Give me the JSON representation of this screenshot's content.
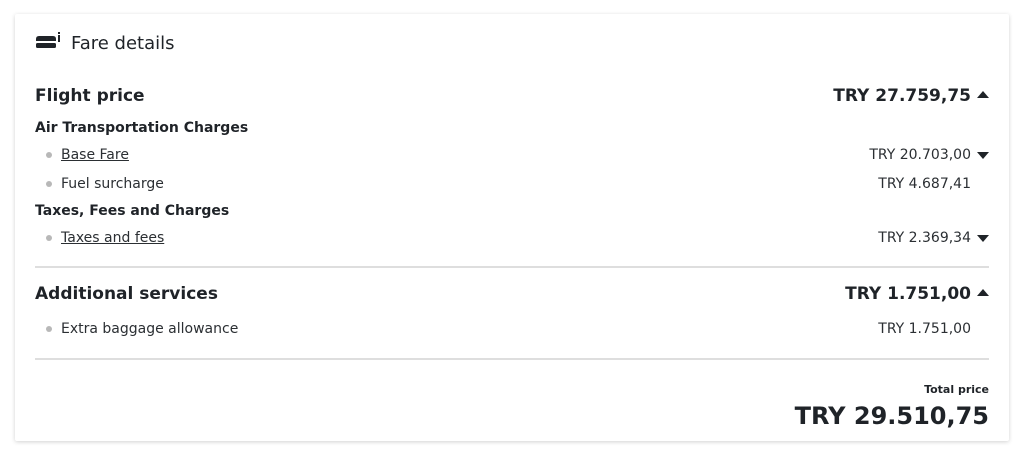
{
  "header": {
    "title": "Fare details",
    "icon": "seat-info-icon"
  },
  "flight_price": {
    "title": "Flight price",
    "amount": "TRY 27.759,75",
    "groups": [
      {
        "title": "Air Transportation Charges",
        "items": [
          {
            "label": "Base Fare",
            "amount": "TRY 20.703,00"
          },
          {
            "label": "Fuel surcharge",
            "amount": "TRY 4.687,41"
          }
        ]
      },
      {
        "title": "Taxes, Fees and Charges",
        "items": [
          {
            "label": "Taxes and fees",
            "amount": "TRY 2.369,34"
          }
        ]
      }
    ]
  },
  "additional_services": {
    "title": "Additional services",
    "amount": "TRY 1.751,00",
    "items": [
      {
        "label": "Extra baggage allowance",
        "amount": "TRY 1.751,00"
      }
    ]
  },
  "total": {
    "label": "Total price",
    "amount": "TRY 29.510,75"
  }
}
